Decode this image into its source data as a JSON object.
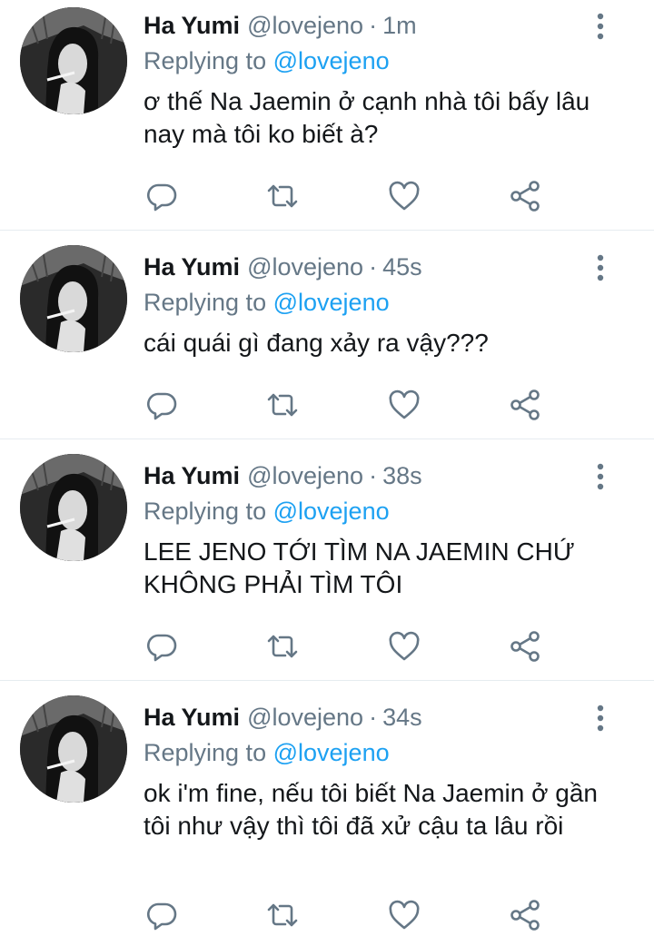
{
  "tweets": [
    {
      "author": "Ha Yumi",
      "handle": "@lovejeno",
      "separator": "·",
      "time": "1m",
      "replying_prefix": "Replying to",
      "replying_to": "@lovejeno",
      "text": "ơ thế Na Jaemin ở cạnh nhà tôi bấy lâu nay mà tôi ko biết à?"
    },
    {
      "author": "Ha Yumi",
      "handle": "@lovejeno",
      "separator": "·",
      "time": "45s",
      "replying_prefix": "Replying to",
      "replying_to": "@lovejeno",
      "text": "cái quái gì đang xảy ra vậy???"
    },
    {
      "author": "Ha Yumi",
      "handle": "@lovejeno",
      "separator": "·",
      "time": "38s",
      "replying_prefix": "Replying to",
      "replying_to": "@lovejeno",
      "text": "LEE JENO TỚI TÌM NA JAEMIN CHỨ KHÔNG PHẢI TÌM TÔI"
    },
    {
      "author": "Ha Yumi",
      "handle": "@lovejeno",
      "separator": "·",
      "time": "34s",
      "replying_prefix": "Replying to",
      "replying_to": "@lovejeno",
      "text": "ok i'm fine, nếu tôi biết Na Jaemin ở gần tôi như vậy thì tôi đã xử cậu ta lâu rồi"
    }
  ],
  "icons": {
    "reply": "comment-icon",
    "retweet": "retweet-icon",
    "like": "heart-icon",
    "share": "share-icon",
    "more": "more-vertical-icon"
  },
  "colors": {
    "link": "#1da1f2",
    "secondary_text": "#657786",
    "divider": "#e6ecf0"
  }
}
